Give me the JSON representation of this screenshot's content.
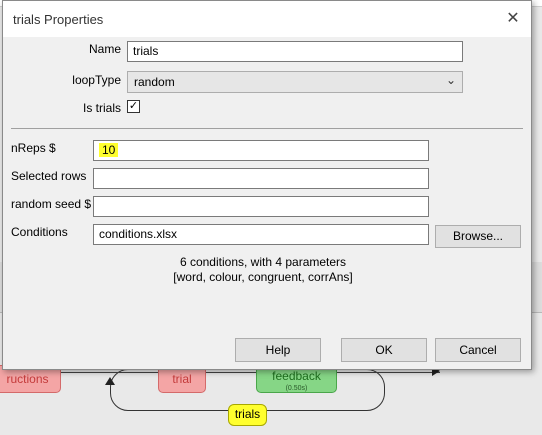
{
  "dialog": {
    "title": "trials Properties",
    "close_glyph": "✕",
    "fields": {
      "name": {
        "label": "Name",
        "value": "trials"
      },
      "loop_type": {
        "label": "loopType",
        "value": "random"
      },
      "is_trials": {
        "label": "Is trials",
        "checked": true,
        "check_glyph": "✓"
      },
      "nreps": {
        "label": "nReps $",
        "value": "10"
      },
      "selected_rows": {
        "label": "Selected rows",
        "value": ""
      },
      "random_seed": {
        "label": "random seed $",
        "value": ""
      },
      "conditions": {
        "label": "Conditions",
        "value": "conditions.xlsx"
      }
    },
    "browse_label": "Browse...",
    "conditions_info": {
      "line1": "6 conditions, with 4 parameters",
      "line2": "[word, colour, congruent, corrAns]"
    },
    "buttons": {
      "help": "Help",
      "ok": "OK",
      "cancel": "Cancel"
    }
  },
  "flow": {
    "routines": {
      "instructions": "ructions",
      "trial": "trial",
      "feedback": "feedback",
      "feedback_duration": "(0.50s)"
    },
    "loop_label": "trials"
  },
  "icons": {
    "dropdown": "chevron-down-icon",
    "close": "close-icon",
    "check": "checkmark-icon"
  }
}
